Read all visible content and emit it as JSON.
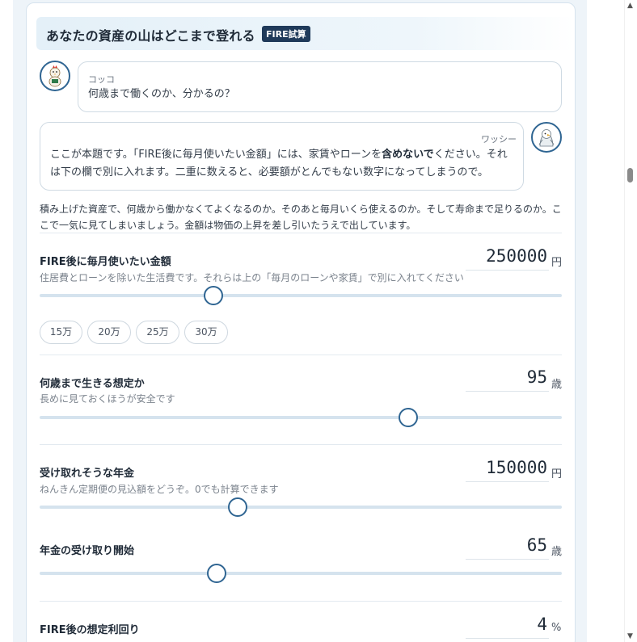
{
  "header": {
    "title": "あなたの資産の山はどこまで登れる",
    "badge": "FIRE試算"
  },
  "chat": [
    {
      "speaker": "コッコ",
      "text": "何歳まで働くのか、分かるの？"
    },
    {
      "speaker": "ワッシー",
      "text_before": "ここが本題です。「FIRE後に毎月使いたい金額」には、家賃やローンを",
      "text_bold": "含めないで",
      "text_after": "ください。それは下の欄で別に入れます。二重に数えると、必要額がとんでもない数字になってしまうので。"
    }
  ],
  "intro": "積み上げた資産で、何歳から働かなくてよくなるのか。そのあと毎月いくら使えるのか。そして寿命まで足りるのか。ここで一気に見てしまいましょう。金額は物価の上昇を差し引いたうえで出しています。",
  "fields": {
    "monthly_spend": {
      "label": "FIRE後に毎月使いたい金額",
      "help": "住居費とローンを除いた生活費です。それらは上の「毎月のローンや家賃」で別に入れてください",
      "value": "250000",
      "unit": "円",
      "slider_fraction": 0.33
    },
    "life_expectancy": {
      "label": "何歳まで生きる想定か",
      "help": "長めに見ておくほうが安全です",
      "value": "95",
      "unit": "歳",
      "slider_fraction": 0.7
    },
    "pension": {
      "label": "受け取れそうな年金",
      "help": "ねんきん定期便の見込額をどうぞ。0でも計算できます",
      "value": "150000",
      "unit": "円",
      "slider_fraction": 0.38
    },
    "pension_start": {
      "label": "年金の受け取り開始",
      "value": "65",
      "unit": "歳",
      "slider_fraction": 0.34
    },
    "return_rate": {
      "label": "FIRE後の想定利回り",
      "value": "4",
      "unit": "%"
    }
  },
  "presets": [
    "15万",
    "20万",
    "25万",
    "30万"
  ]
}
